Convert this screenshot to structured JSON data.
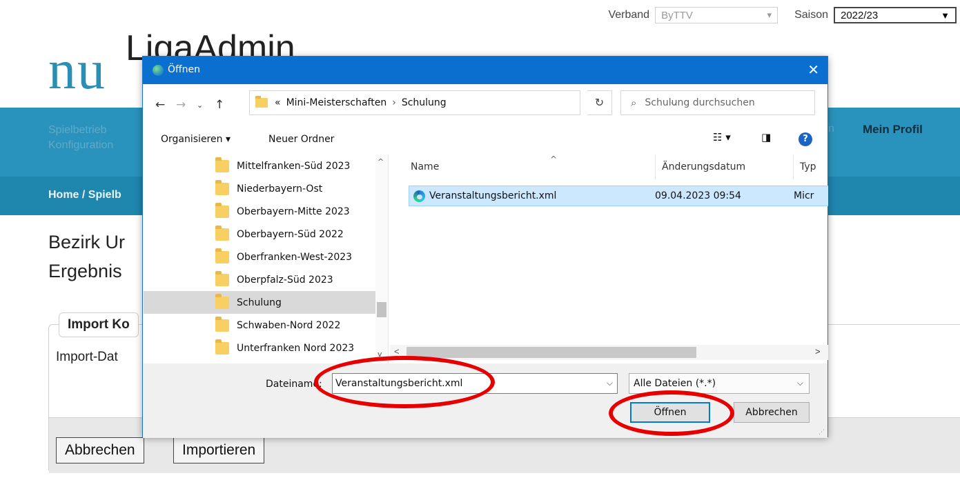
{
  "header": {
    "verband_label": "Verband",
    "verband_value": "ByTTV",
    "saison_label": "Saison",
    "saison_value": "2022/23"
  },
  "logo": {
    "nu": "nu",
    "liga": "LigaAdmin"
  },
  "nav": {
    "left_line1": "Spielbetrieb",
    "left_line2": "Konfiguration",
    "partial": "n",
    "profile": "Mein Profil"
  },
  "breadcrumb": "Home / Spielb",
  "page": {
    "title_line1": "Bezirk Ur",
    "title_line2": "Ergebnis",
    "import_legend": "Import Ko",
    "import_file_label": "Import-Dat",
    "cancel_button": "Abbrechen",
    "import_button": "Importieren"
  },
  "dialog": {
    "title": "Öffnen",
    "close": "✕",
    "address": {
      "prefix": "«",
      "parent": "Mini-Meisterschaften",
      "separator": "›",
      "current": "Schulung"
    },
    "search_placeholder": "Schulung durchsuchen",
    "toolbar": {
      "organize": "Organisieren ▾",
      "new_folder": "Neuer Ordner",
      "help": "?"
    },
    "tree": [
      "Mittelfranken-Süd 2023",
      "Niederbayern-Ost",
      "Oberbayern-Mitte 2023",
      "Oberbayern-Süd 2022",
      "Oberfranken-West-2023",
      "Oberpfalz-Süd 2023",
      "Schulung",
      "Schwaben-Nord 2022",
      "Unterfranken Nord 2023"
    ],
    "columns": {
      "name": "Name",
      "date": "Änderungsdatum",
      "type": "Typ"
    },
    "files": [
      {
        "name": "Veranstaltungsbericht.xml",
        "date": "09.04.2023 09:54",
        "type": "Micr"
      }
    ],
    "filename_label": "Dateiname:",
    "filename_value": "Veranstaltungsbericht.xml",
    "filter_value": "Alle Dateien (*.*)",
    "open_button": "Öffnen",
    "cancel_button": "Abbrechen"
  },
  "colors": {
    "nav_blue": "#2a93bd",
    "breadcrumb_blue": "#1f86ae",
    "dialog_title_blue": "#0b6fcf",
    "annotation_red": "#e60000"
  }
}
